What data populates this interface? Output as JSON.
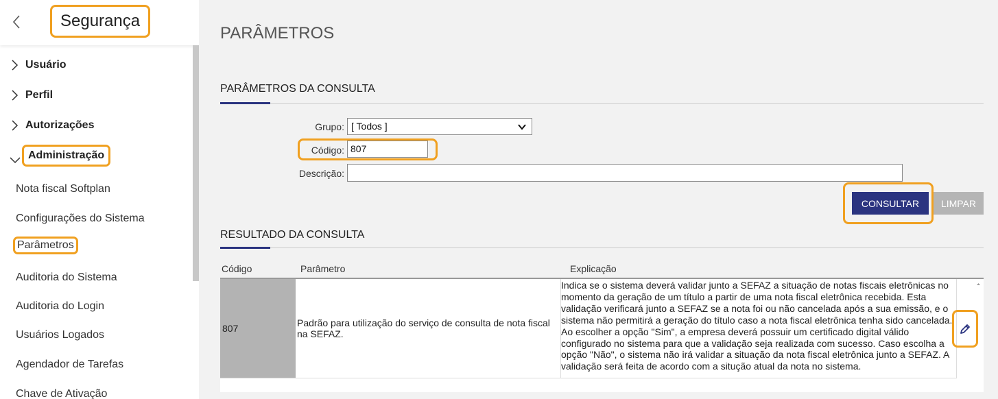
{
  "sidebar": {
    "title": "Segurança",
    "groups": [
      {
        "label": "Usuário"
      },
      {
        "label": "Perfil"
      },
      {
        "label": "Autorizações"
      },
      {
        "label": "Administração"
      }
    ],
    "items": [
      {
        "label": "Nota fiscal Softplan"
      },
      {
        "label": "Configurações do Sistema"
      },
      {
        "label": "Parâmetros"
      },
      {
        "label": "Auditoria do Sistema"
      },
      {
        "label": "Auditoria do Login"
      },
      {
        "label": "Usuários Logados"
      },
      {
        "label": "Agendador de Tarefas"
      },
      {
        "label": "Chave de Ativação"
      }
    ]
  },
  "main": {
    "page_title": "PARÂMETROS",
    "query_section_title": "PARÂMETROS DA CONSULTA",
    "form": {
      "grupo_label": "Grupo:",
      "grupo_value": "[ Todos ]",
      "codigo_label": "Código:",
      "codigo_value": "807",
      "descricao_label": "Descrição:",
      "descricao_value": ""
    },
    "buttons": {
      "consultar": "CONSULTAR",
      "limpar": "LIMPAR"
    },
    "result_section_title": "RESULTADO DA CONSULTA",
    "table": {
      "headers": [
        "Código",
        "Parâmetro",
        "Explicação"
      ],
      "rows": [
        {
          "codigo": "807",
          "parametro": "Padrão para utilização do serviço de consulta de nota fiscal na SEFAZ.",
          "explicacao": "Indica se o sistema deverá validar junto a SEFAZ a situação de notas fiscais eletrônicas no momento da geração de um título a partir de uma nota fiscal eletrônica recebida. Esta validação verificará junto a SEFAZ se a nota foi ou não cancelada após a sua emissão, e o sistema não permitirá a geração do título caso a nota fiscal eletrônica tenha sido cancelada. Ao escolher a opção \"Sim\", a empresa deverá possuir um certificado digital válido configurado no sistema para que a validação seja realizada com sucesso. Caso escolha a opção \"Não\", o sistema não irá validar a situação da nota fiscal eletrônica junto a SEFAZ. A validação será feita de acordo com a situção atual da nota no sistema."
        }
      ]
    }
  },
  "colors": {
    "accent": "#2b3480",
    "highlight": "#f0a020",
    "disabled": "#b5b5b5"
  },
  "icons": {
    "back": "chevron-left-icon",
    "group_collapsed": "chevron-right-icon",
    "group_expanded": "chevron-down-icon",
    "edit": "pencil-icon"
  }
}
